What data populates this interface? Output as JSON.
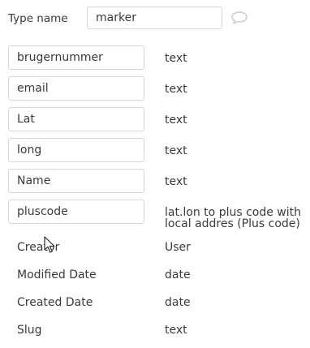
{
  "type_name": {
    "label": "Type name",
    "value": "marker",
    "comment_icon": "speech-bubble-icon"
  },
  "editable_fields": [
    {
      "name": "brugernummer",
      "type": "text"
    },
    {
      "name": "email",
      "type": "text"
    },
    {
      "name": "Lat",
      "type": "text"
    },
    {
      "name": "long",
      "type": "text"
    },
    {
      "name": "Name",
      "type": "text"
    },
    {
      "name": "pluscode",
      "type_line1": "lat.lon to plus code with",
      "type_line2": "local addres (Plus code)"
    }
  ],
  "builtin_fields": [
    {
      "name": "Creator",
      "type": "User"
    },
    {
      "name": "Modified Date",
      "type": "date"
    },
    {
      "name": "Created Date",
      "type": "date"
    },
    {
      "name": "Slug",
      "type": "text"
    }
  ],
  "icons": {
    "cursor": "mouse-pointer-icon"
  },
  "colors": {
    "border": "#d6d6d6",
    "text": "#3a3a3a",
    "icon": "#c8c8c8"
  }
}
